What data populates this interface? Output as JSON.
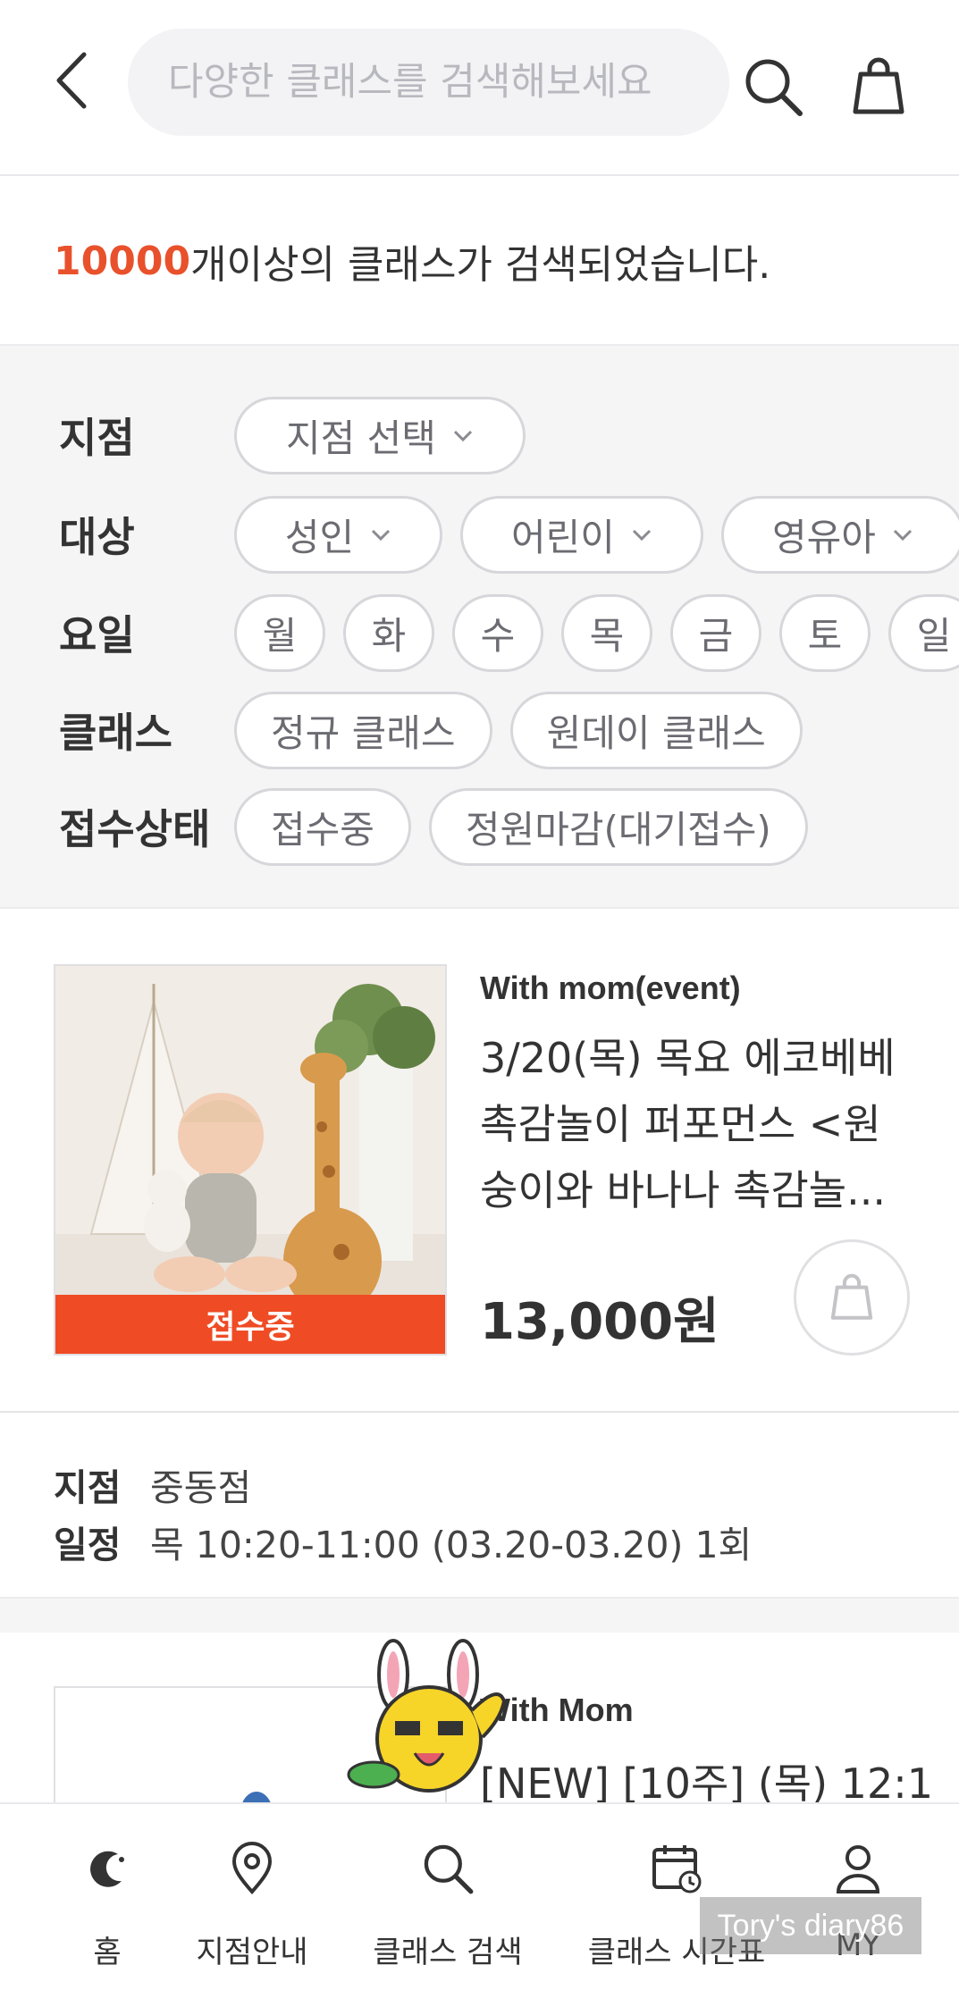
{
  "header": {
    "search_placeholder": "다양한 클래스를 검색해보세요"
  },
  "result": {
    "count": "10000",
    "suffix": "개이상의 클래스가 검색되었습니다."
  },
  "filters": {
    "branch": {
      "label": "지점",
      "chips": [
        "지점 선택"
      ]
    },
    "target": {
      "label": "대상",
      "chips": [
        "성인",
        "어린이",
        "영유아"
      ]
    },
    "day": {
      "label": "요일",
      "chips": [
        "월",
        "화",
        "수",
        "목",
        "금",
        "토",
        "일"
      ]
    },
    "class": {
      "label": "클래스",
      "chips": [
        "정규 클래스",
        "원데이 클래스"
      ]
    },
    "status": {
      "label": "접수상태",
      "chips": [
        "접수중",
        "정원마감(대기접수)"
      ]
    }
  },
  "product": {
    "category": "With mom(event)",
    "title": "3/20(목) 목요 에코베베 촉감놀이 퍼포먼스 <원숭이와 바나나 촉감놀...",
    "price": "13,000원",
    "status": "접수중",
    "branch_label": "지점",
    "branch_value": "중동점",
    "schedule_label": "일정",
    "schedule_value": "목 10:20-11:00 (03.20-03.20) 1회"
  },
  "product2": {
    "category": "With Mom",
    "title": "[NEW] [10주] (목) 12:1"
  },
  "bottom_nav": {
    "home": "홈",
    "branch": "지점안내",
    "search": "클래스 검색",
    "timetable": "클래스 시간표",
    "my": "MY"
  },
  "watermark": "Tory's diary86",
  "colors": {
    "accent": "#e8512c",
    "status_strip": "#ef4b24",
    "filter_bg": "#f5f5f6"
  }
}
